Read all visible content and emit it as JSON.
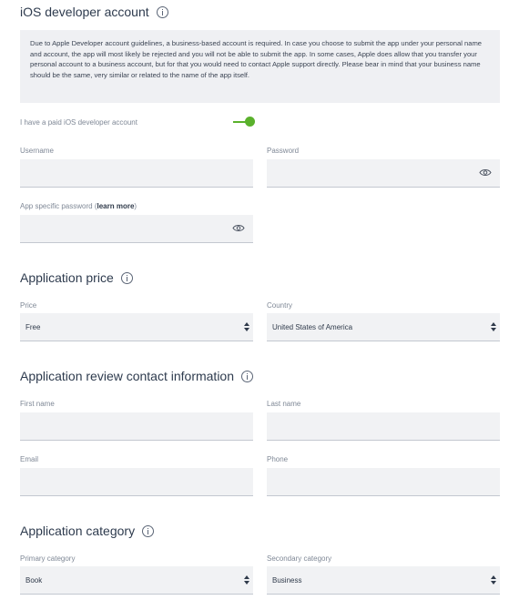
{
  "ios_account": {
    "title": "iOS developer account",
    "notice": "Due to Apple Developer account guidelines, a business-based account is required. In case you choose to submit the app under your personal name and account, the app will most likely be rejected and you will not be able to submit the app. In some cases, Apple does allow that you transfer your personal account to a business account, but for that you would need to contact Apple support directly. Please bear in mind that your business name should be the same, very similar or related to the name of the app itself.",
    "toggle_label": "I have a paid iOS developer account",
    "toggle_on": true,
    "toggle_color": "#5ab12c",
    "username_label": "Username",
    "username_value": "",
    "password_label": "Password",
    "password_value": "",
    "app_password_label_prefix": "App specific password (",
    "app_password_link": "learn more",
    "app_password_label_suffix": ")",
    "app_password_value": ""
  },
  "price": {
    "title": "Application price",
    "price_label": "Price",
    "price_value": "Free",
    "country_label": "Country",
    "country_value": "United States of America"
  },
  "review_contact": {
    "title": "Application review contact information",
    "first_name_label": "First name",
    "first_name_value": "",
    "last_name_label": "Last name",
    "last_name_value": "",
    "email_label": "Email",
    "email_value": "",
    "phone_label": "Phone",
    "phone_value": ""
  },
  "category": {
    "title": "Application category",
    "primary_label": "Primary category",
    "primary_value": "Book",
    "secondary_label": "Secondary category",
    "secondary_value": "Business"
  },
  "icons": {
    "info": "info-circle-icon",
    "reveal": "eye-icon",
    "select": "updown-caret-icon"
  }
}
